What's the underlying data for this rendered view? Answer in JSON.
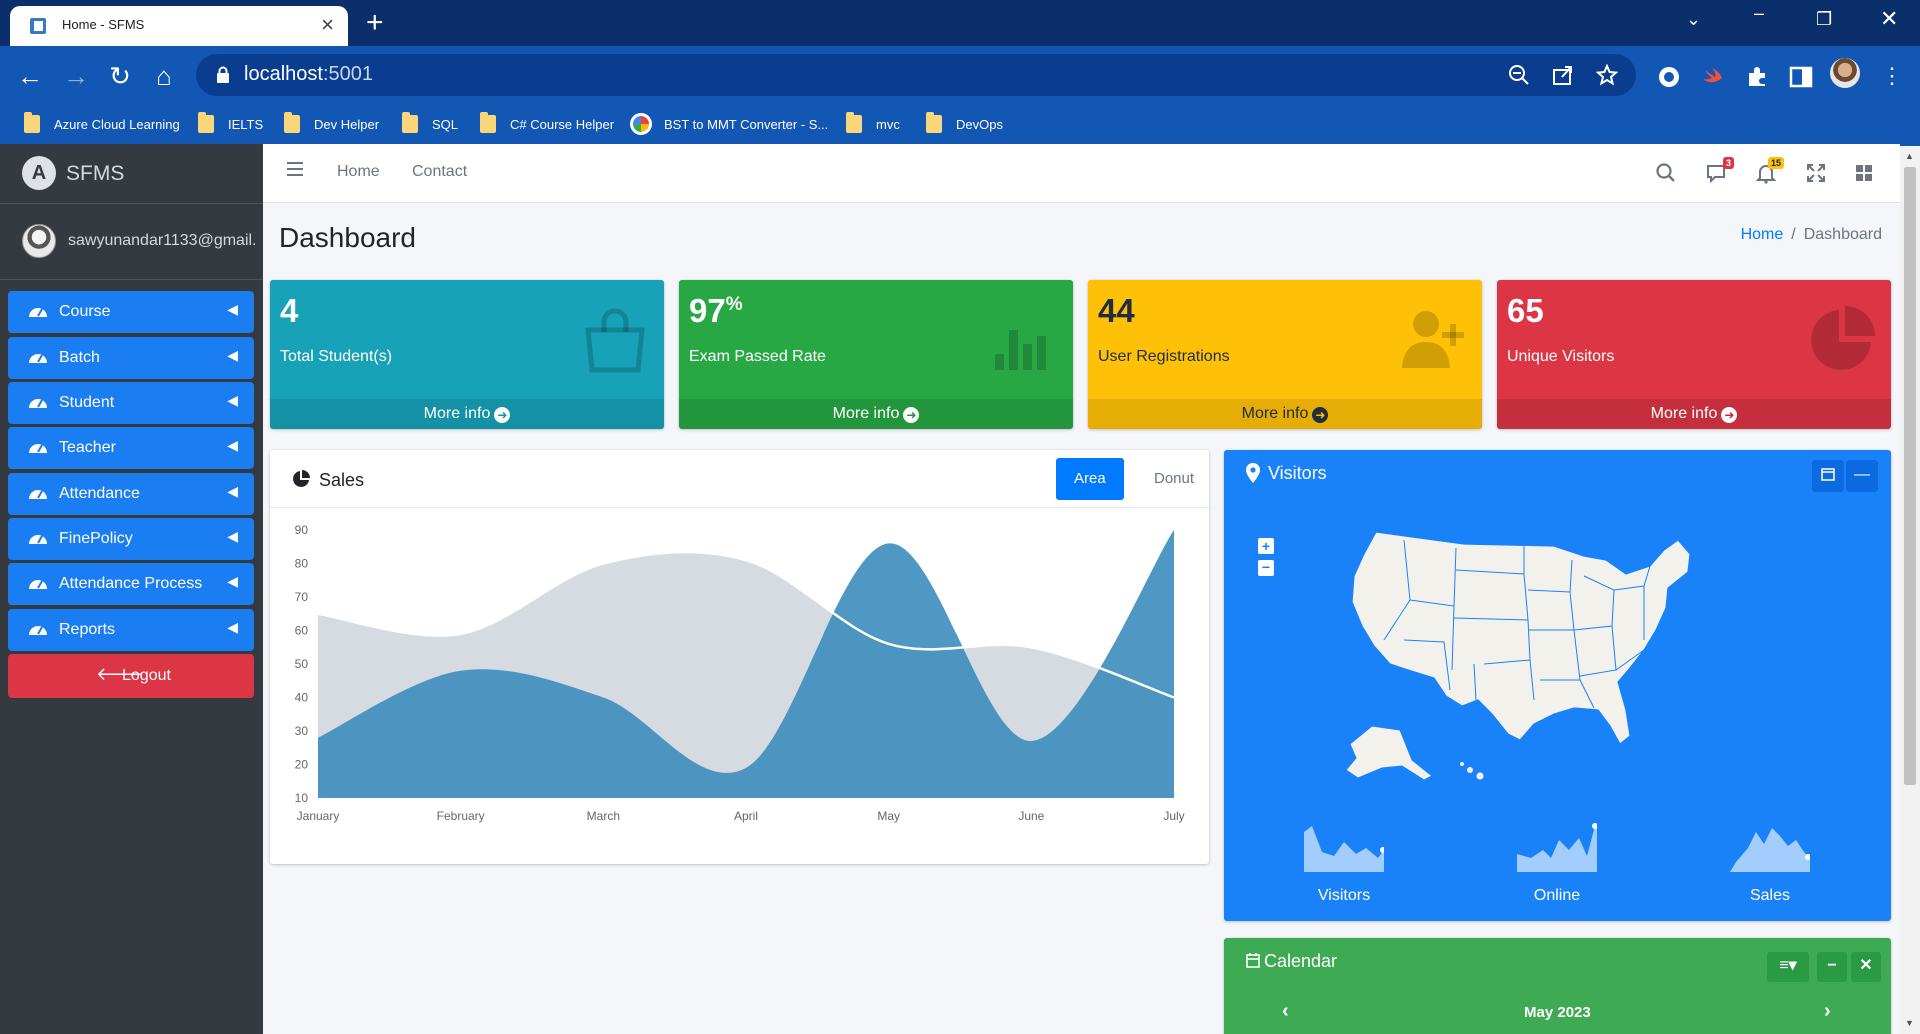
{
  "browser": {
    "tab_title": "Home - SFMS",
    "url_host": "localhost",
    "url_port": ":5001",
    "bookmarks": [
      "Azure Cloud Learning",
      "IELTS",
      "Dev Helper",
      "SQL",
      "C# Course Helper",
      "BST to MMT Converter - S...",
      "mvc",
      "DevOps"
    ]
  },
  "sidebar": {
    "brand": "SFMS",
    "user": "sawyunandar1133@gmail.",
    "items": [
      {
        "label": "Course"
      },
      {
        "label": "Batch"
      },
      {
        "label": "Student"
      },
      {
        "label": "Teacher"
      },
      {
        "label": "Attendance"
      },
      {
        "label": "FinePolicy"
      },
      {
        "label": "Attendance Process"
      },
      {
        "label": "Reports"
      }
    ],
    "logout": "Logout"
  },
  "header": {
    "links": [
      "Home",
      "Contact"
    ],
    "messages_badge": "3",
    "notifications_badge": "15"
  },
  "page": {
    "title": "Dashboard",
    "breadcrumb": [
      "Home",
      "Dashboard"
    ]
  },
  "stats": [
    {
      "value": "4",
      "label": "Total Student(s)",
      "footer": "More info",
      "color": "#17a2b8",
      "icon": "shopping-bag-icon"
    },
    {
      "value": "97",
      "suffix": "%",
      "label": "Exam Passed Rate",
      "footer": "More info",
      "color": "#28a745",
      "icon": "bar-chart-icon"
    },
    {
      "value": "44",
      "label": "User Registrations",
      "footer": "More info",
      "color": "#ffc107",
      "icon": "user-plus-icon"
    },
    {
      "value": "65",
      "label": "Unique Visitors",
      "footer": "More info",
      "color": "#dc3545",
      "icon": "pie-chart-icon"
    }
  ],
  "sales": {
    "title": "Sales",
    "tabs": [
      "Area",
      "Donut"
    ],
    "active_tab": "Area"
  },
  "visitors": {
    "title": "Visitors",
    "sparklines": [
      "Visitors",
      "Online",
      "Sales"
    ]
  },
  "calendar": {
    "title": "Calendar",
    "month": "May 2023"
  },
  "chart_data": {
    "type": "area",
    "categories": [
      "January",
      "February",
      "March",
      "April",
      "May",
      "June",
      "July"
    ],
    "ylim": [
      10,
      90
    ],
    "yticks": [
      90,
      80,
      70,
      60,
      50,
      40,
      30,
      20,
      10
    ],
    "series": [
      {
        "values": [
          65,
          59,
          80,
          81,
          56,
          55,
          40
        ],
        "color": "#d2d6de"
      },
      {
        "values": [
          28,
          48,
          40,
          19,
          86,
          27,
          90
        ],
        "color": "#3c8dbc"
      }
    ]
  }
}
